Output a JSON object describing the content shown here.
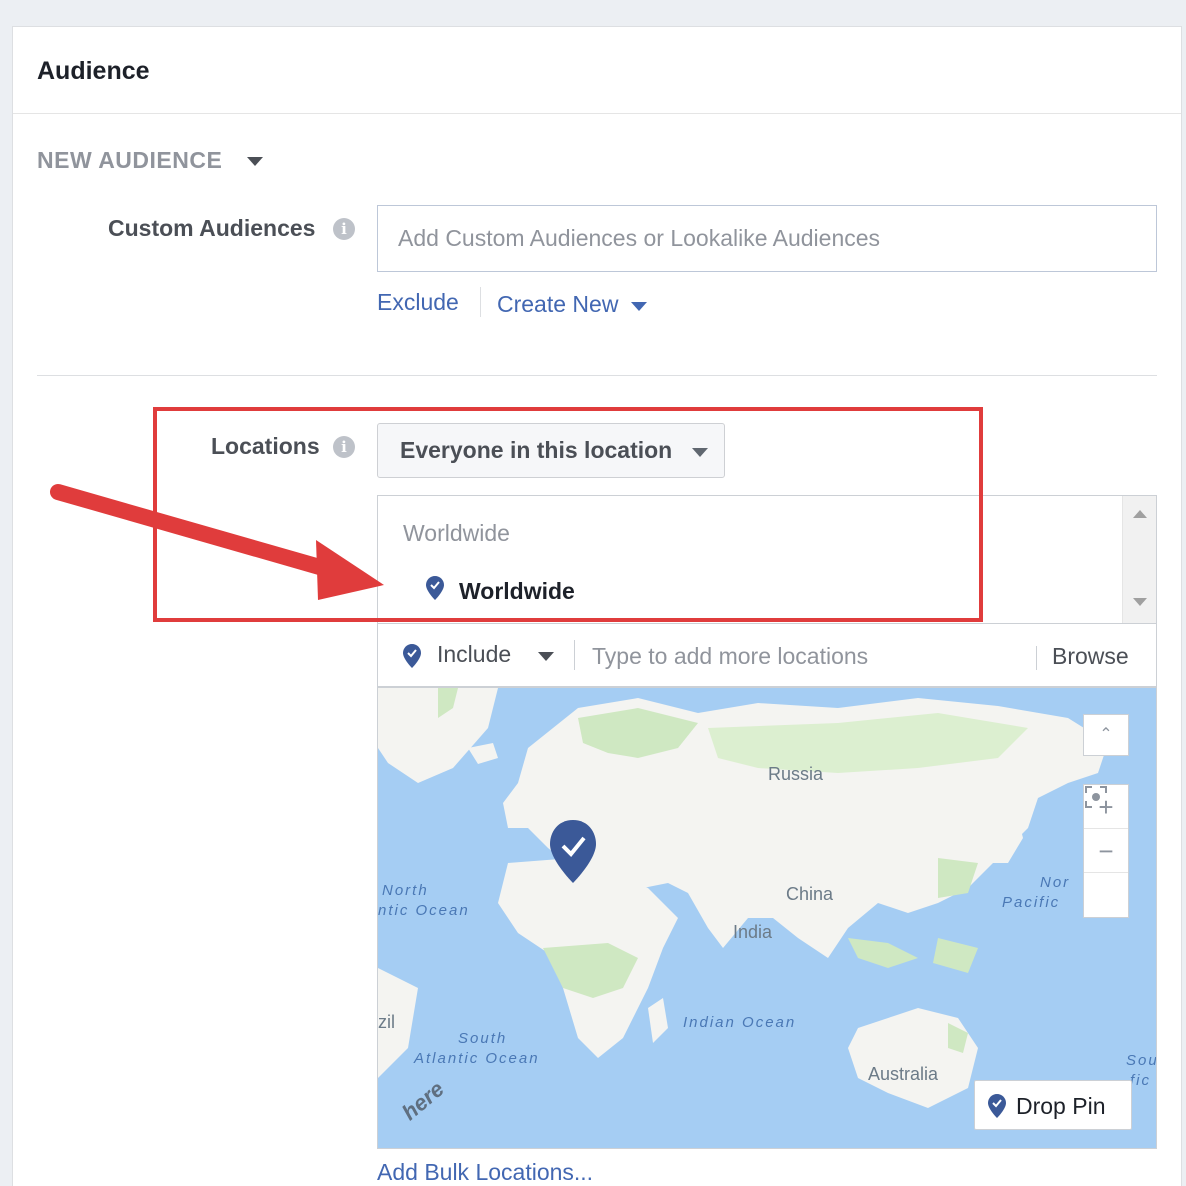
{
  "panel": {
    "title": "Audience"
  },
  "new_audience": {
    "label": "NEW AUDIENCE"
  },
  "custom_audiences": {
    "label": "Custom Audiences",
    "placeholder": "Add Custom Audiences or Lookalike Audiences",
    "exclude_link": "Exclude",
    "create_new_link": "Create New"
  },
  "locations": {
    "label": "Locations",
    "selector_value": "Everyone in this location",
    "list_group": "Worldwide",
    "list_item": "Worldwide",
    "include_label": "Include",
    "search_placeholder": "Type to add more locations",
    "browse_label": "Browse",
    "map": {
      "labels": {
        "russia": "Russia",
        "china": "China",
        "india": "India",
        "australia": "Australia",
        "north_atlantic_1": "North",
        "north_atlantic_2": "ntic Ocean",
        "north_pacific_1": "Nor",
        "north_pacific_2": "Pacific",
        "south_atlantic_1": "South",
        "south_atlantic_2": "Atlantic Ocean",
        "indian_ocean": "Indian Ocean",
        "brazil_fragment": "zil",
        "south_pacific_1": "Sou",
        "south_pacific_2": "fic",
        "here": "here"
      },
      "controls": {
        "zoom_in": "+",
        "zoom_out": "−"
      },
      "drop_pin_label": "Drop Pin"
    },
    "bulk_link": "Add Bulk Locations..."
  },
  "colors": {
    "link": "#4267b2",
    "pin": "#3b5998",
    "highlight": "#e03c3c",
    "ocean": "#a5cdf3",
    "land": "#f4f4f1",
    "vegetation": "#cfe8c2"
  }
}
